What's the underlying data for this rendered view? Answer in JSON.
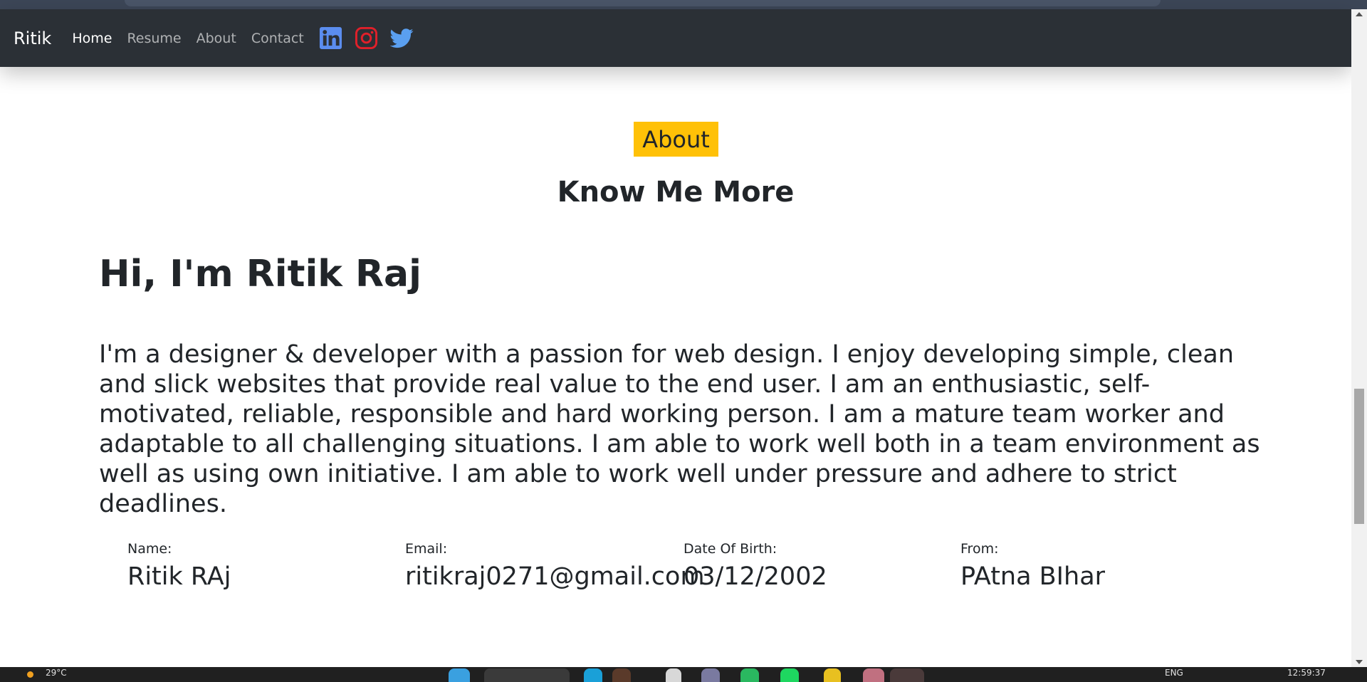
{
  "navbar": {
    "brand": "Ritik",
    "links": [
      {
        "label": "Home",
        "active": true
      },
      {
        "label": "Resume",
        "active": false
      },
      {
        "label": "About",
        "active": false
      },
      {
        "label": "Contact",
        "active": false
      }
    ],
    "social_icons": [
      "linkedin-icon",
      "instagram-icon",
      "twitter-icon"
    ]
  },
  "about": {
    "badge": "About",
    "subtitle": "Know Me More",
    "heading": "Hi, I'm Ritik Raj",
    "bio": "I'm a designer & developer with a passion for web design. I enjoy developing simple, clean and slick websites that provide real value to the end user. I am an enthusiastic, self-motivated, reliable, responsible and hard working person. I am a mature team worker and adaptable to all challenging situations. I am able to work well both in a team environment as well as using own initiative. I am able to work well under pressure and adhere to strict deadlines.",
    "info": [
      {
        "label": "Name:",
        "value": "Ritik RAj"
      },
      {
        "label": "Email:",
        "value": "ritikraj0271@gmail.com"
      },
      {
        "label": "Date Of Birth:",
        "value": "03/12/2002"
      },
      {
        "label": "From:",
        "value": "PAtna BIhar"
      }
    ]
  },
  "taskbar": {
    "weather": "29°C",
    "language": "ENG",
    "time": "12:59:37"
  },
  "colors": {
    "navbar_bg": "#2b3036",
    "badge_bg": "#ffc107",
    "linkedin": "#5b8def",
    "instagram": "#e0202a",
    "twitter": "#5a9ff0"
  }
}
